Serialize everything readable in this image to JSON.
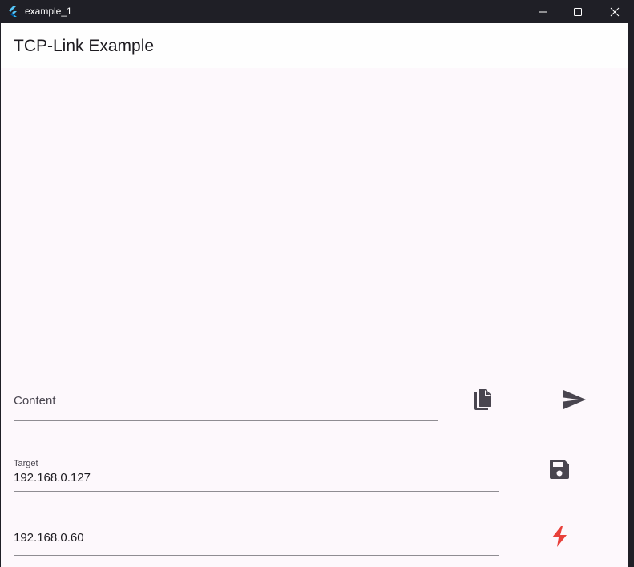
{
  "window": {
    "title": "example_1",
    "app_icon": "flutter-logo-icon",
    "controls": [
      "minimize-icon",
      "maximize-icon",
      "close-icon"
    ]
  },
  "appbar": {
    "title": "TCP-Link Example"
  },
  "content_field": {
    "placeholder": "Content",
    "value": ""
  },
  "target_field": {
    "label": "Target",
    "value": "192.168.0.127"
  },
  "local_field": {
    "value": "192.168.0.60"
  },
  "actions": {
    "copy_icon": "copy-icon",
    "send_icon": "send-icon",
    "save_icon": "save-icon",
    "connect_icon": "bolt-icon"
  },
  "colors": {
    "titlebar": "#1f1f26",
    "surface": "#fdf8fc",
    "icon_dark": "#49454f",
    "connect_accent": "#e8403a"
  }
}
